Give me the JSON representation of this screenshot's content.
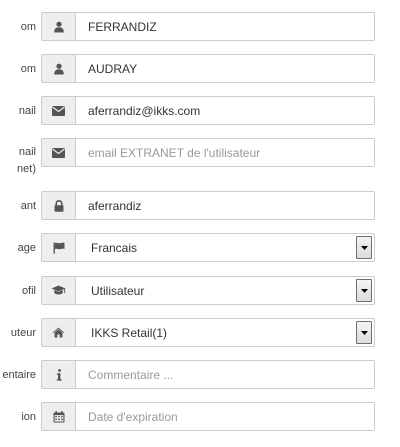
{
  "fields": [
    {
      "label": "om",
      "icon": "user-icon",
      "value": "FERRANDIZ",
      "placeholder": ""
    },
    {
      "label": "om",
      "icon": "user-icon",
      "value": "AUDRAY",
      "placeholder": ""
    },
    {
      "label": "nail",
      "icon": "envelope-icon",
      "value": "aferrandiz@ikks.com",
      "placeholder": ""
    },
    {
      "label_line1": "nail",
      "label_line2": "net)",
      "icon": "envelope-icon",
      "value": "",
      "placeholder": "email EXTRANET de l'utilisateur"
    },
    {
      "label": "ant",
      "icon": "lock-icon",
      "value": "aferrandiz",
      "placeholder": ""
    },
    {
      "label": "age",
      "icon": "flag-icon",
      "value": "Francais"
    },
    {
      "label": "ofil",
      "icon": "graduation-cap-icon",
      "value": "Utilisateur"
    },
    {
      "label": "uteur",
      "icon": "home-icon",
      "value": "IKKS Retail(1)"
    },
    {
      "label": "entaire",
      "icon": "info-icon",
      "value": "",
      "placeholder": "Commentaire ..."
    },
    {
      "label": "ion",
      "icon": "calendar-icon",
      "value": "",
      "placeholder": "Date d'expiration"
    }
  ],
  "colors": {
    "addon_bg": "#eeeeee",
    "border": "#cccccc",
    "icon": "#555555",
    "placeholder": "#999999"
  }
}
